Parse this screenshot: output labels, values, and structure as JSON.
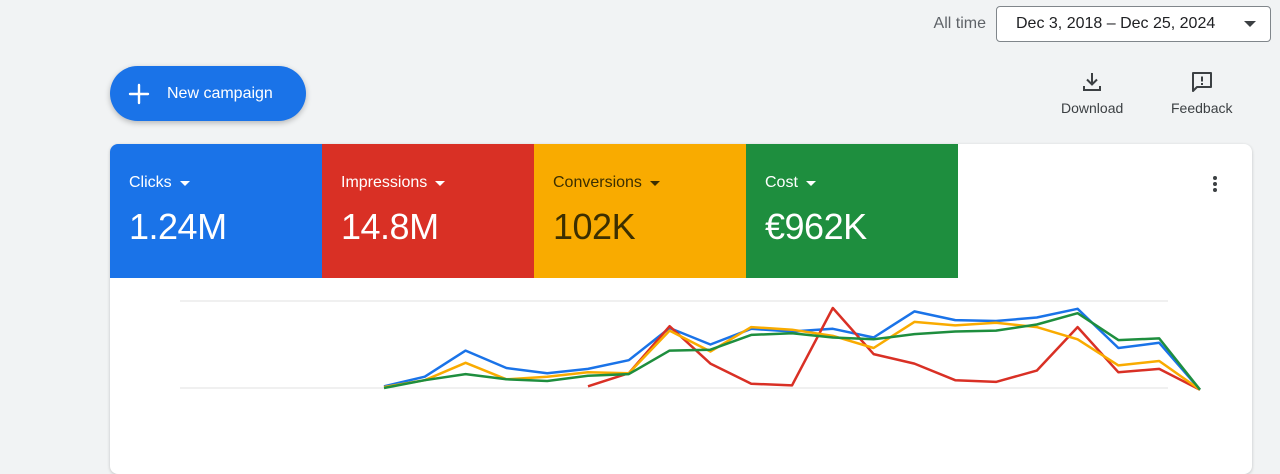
{
  "header": {
    "range_label": "All time",
    "date_range": "Dec 3, 2018 – Dec 25, 2024"
  },
  "toolbar": {
    "new_campaign_label": "New campaign",
    "download_label": "Download",
    "feedback_label": "Feedback"
  },
  "metrics": [
    {
      "label": "Clicks",
      "value": "1.24M",
      "color": "#1a73e8"
    },
    {
      "label": "Impressions",
      "value": "14.8M",
      "color": "#d93025"
    },
    {
      "label": "Conversions",
      "value": "102K",
      "color": "#f9ab00"
    },
    {
      "label": "Cost",
      "value": "€962K",
      "color": "#1e8e3e"
    }
  ],
  "chart_data": {
    "type": "line",
    "grid": true,
    "ylim": [
      0,
      100
    ],
    "series": [
      {
        "color": "#1a73e8",
        "values": [
          null,
          null,
          null,
          null,
          null,
          2,
          13,
          43,
          23,
          17,
          22,
          32,
          69,
          50,
          68,
          65,
          68,
          58,
          88,
          78,
          77,
          81,
          91,
          46,
          52,
          -2
        ]
      },
      {
        "color": "#d93025",
        "values": [
          null,
          null,
          null,
          null,
          null,
          null,
          null,
          null,
          null,
          null,
          2,
          17,
          71,
          28,
          5,
          3,
          92,
          39,
          28,
          9,
          7,
          20,
          70,
          18,
          22,
          -2
        ]
      },
      {
        "color": "#f9ab00",
        "values": [
          null,
          null,
          null,
          null,
          null,
          1,
          9,
          29,
          10,
          13,
          18,
          17,
          66,
          42,
          70,
          67,
          60,
          46,
          76,
          72,
          75,
          70,
          56,
          26,
          31,
          -2
        ]
      },
      {
        "color": "#1e8e3e",
        "values": [
          null,
          null,
          null,
          null,
          null,
          0,
          9,
          16,
          10,
          8,
          14,
          16,
          43,
          44,
          61,
          63,
          58,
          56,
          62,
          65,
          66,
          73,
          86,
          55,
          57,
          -2
        ]
      }
    ]
  }
}
